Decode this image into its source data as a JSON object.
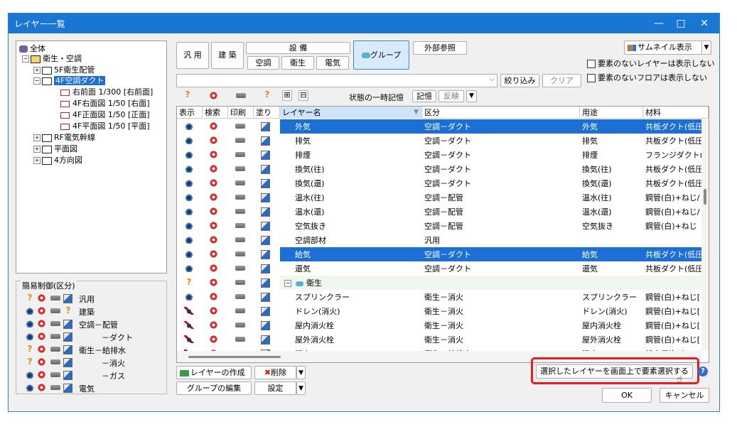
{
  "window": {
    "title": "レイヤー一覧",
    "minimize": "—",
    "maximize": "□",
    "close": "✕"
  },
  "tree": {
    "items": [
      {
        "label": "全体",
        "level": 0
      },
      {
        "label": "衛生・空調",
        "level": 1,
        "expander": "−"
      },
      {
        "label": "5F衛生配管",
        "level": 2,
        "expander": "+"
      },
      {
        "label": "4F空調ダクト",
        "level": 2,
        "expander": "−",
        "selected": true
      },
      {
        "label": "右前面 1/300 [右前面]",
        "level": 3
      },
      {
        "label": "4F右面図 1/50 [右面]",
        "level": 3
      },
      {
        "label": "4F正面図 1/50 [正面]",
        "level": 3
      },
      {
        "label": "4F平面図 1/50 [平面]",
        "level": 3
      },
      {
        "label": "RF電気幹線",
        "level": 2,
        "expander": "+"
      },
      {
        "label": "平面図",
        "level": 2,
        "expander": "+"
      },
      {
        "label": "4方向図",
        "level": 2,
        "expander": "+"
      }
    ]
  },
  "simple_control": {
    "title": "簡易制御(区分)",
    "rows": [
      {
        "label": "汎用",
        "first": "question"
      },
      {
        "label": "建築",
        "first": "eye",
        "last": "question"
      },
      {
        "label": "空調－配管",
        "first": "eye"
      },
      {
        "label": "－ダクト",
        "first": "eye"
      },
      {
        "label": "衛生－給排水",
        "first": "question"
      },
      {
        "label": "－消火",
        "first": "question"
      },
      {
        "label": "－ガス",
        "first": "eye"
      },
      {
        "label": "電気",
        "first": "eye"
      }
    ]
  },
  "category_buttons": {
    "general": "汎 用",
    "building": "建 築",
    "equipment": "設 備",
    "aircon": "空調",
    "sanitary": "衛生",
    "electric": "電気",
    "group": "グループ",
    "external_ref": "外部参照"
  },
  "filter": {
    "placeholder": "",
    "narrow": "絞り込み",
    "clear": "クリア"
  },
  "toolbar": {
    "temp_state": "状態の一時記憶",
    "remember": "記憶",
    "apply": "反映",
    "expand_all": "⊞",
    "collapse_all": "⊟"
  },
  "right_options": {
    "thumbnail": "サムネイル表示",
    "hide_empty_layers": "要素のないレイヤーは表示しない",
    "hide_empty_floors": "要素のないフロアは表示しない"
  },
  "table": {
    "headers": {
      "show": "表示",
      "search": "検索",
      "print": "印刷",
      "paint": "塗り",
      "name": "レイヤー名",
      "category": "区分",
      "usage": "用途",
      "material": "材料"
    },
    "rows": [
      {
        "name": "外気",
        "category": "空調－ダクト",
        "usage": "外気",
        "material": "共板ダクト(低圧)",
        "selected": true
      },
      {
        "name": "排気",
        "category": "空調－ダクト",
        "usage": "排気",
        "material": "共板ダクト(低圧)"
      },
      {
        "name": "排煙",
        "category": "空調－ダクト",
        "usage": "排煙",
        "material": "フランジダクト(高圧)"
      },
      {
        "name": "換気(往)",
        "category": "空調－ダクト",
        "usage": "換気(往)",
        "material": "共板ダクト(低圧)"
      },
      {
        "name": "換気(還)",
        "category": "空調－ダクト",
        "usage": "換気(還)",
        "material": "共板ダクト(低圧)"
      },
      {
        "name": "温水(往)",
        "category": "空調－配管",
        "usage": "温水(往)",
        "material": "鋼管(白)+ねじ/"
      },
      {
        "name": "温水(還)",
        "category": "空調－配管",
        "usage": "温水(還)",
        "material": "鋼管(白)+ねじ/"
      },
      {
        "name": "空気抜き",
        "category": "空調－配管",
        "usage": "空気抜き",
        "material": "鋼管(白)+ねじ"
      },
      {
        "name": "空調部材",
        "category": "汎用",
        "usage": "",
        "material": ""
      },
      {
        "name": "給気",
        "category": "空調－ダクト",
        "usage": "給気",
        "material": "共板ダクト(低圧)",
        "selected": true
      },
      {
        "name": "還気",
        "category": "空調－ダクト",
        "usage": "還気",
        "material": "共板ダクト(低圧)"
      },
      {
        "name": "衛生",
        "category": "",
        "usage": "",
        "material": "",
        "group": true,
        "expander": "−"
      },
      {
        "name": "スプリンクラー",
        "category": "衛生－消火",
        "usage": "スプリンクラー",
        "material": "鋼管(白)+ねじ["
      },
      {
        "name": "ドレン(消火)",
        "category": "衛生－消火",
        "usage": "ドレン(消火)",
        "material": "鋼管(白)+ねじ["
      },
      {
        "name": "屋内消火栓",
        "category": "衛生－消火",
        "usage": "屋内消火栓",
        "material": "鋼管(白)+ねじ["
      },
      {
        "name": "屋外消火栓",
        "category": "衛生－消火",
        "usage": "屋外消火栓",
        "material": "鋼管(白)+ねじ["
      },
      {
        "name": "汚水",
        "category": "衛生－給排水",
        "usage": "汚水",
        "material": "排水用塩ビライニ"
      }
    ]
  },
  "bottom": {
    "create_layer": "レイヤーの作成",
    "delete": "削除",
    "edit_group": "グループの編集",
    "settings": "設定",
    "select_on_screen": "選択したレイヤーを画面上で要素選択する",
    "ok": "OK",
    "cancel": "キャンセル",
    "help": "?"
  },
  "colors": {
    "titlebar": "#1976d2",
    "selection": "#1e6fd3",
    "highlight_box": "#e02020"
  }
}
